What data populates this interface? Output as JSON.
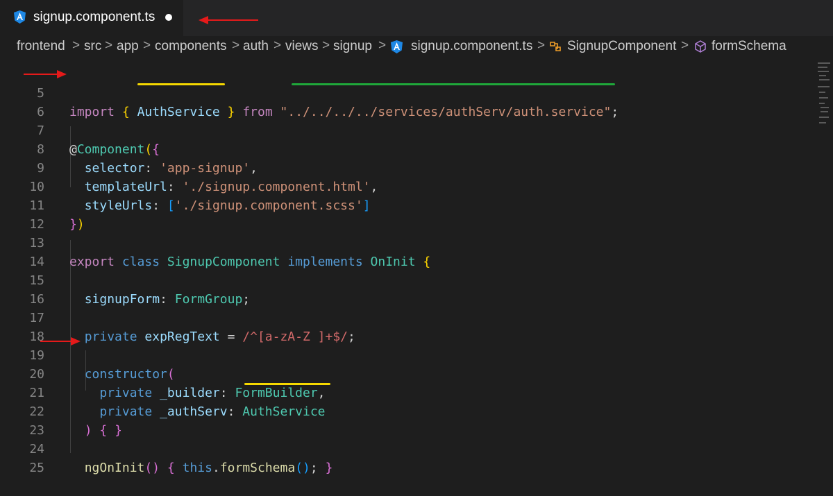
{
  "tab": {
    "title": "signup.component.ts",
    "icon": "angular-icon",
    "dirty": true
  },
  "breadcrumb": {
    "items": [
      "frontend",
      "src",
      "app",
      "components",
      "auth",
      "views",
      "signup",
      "signup.component.ts",
      "SignupComponent",
      "formSchema"
    ],
    "separator": ">"
  },
  "editor": {
    "lines": [
      {
        "n": "5",
        "text": "import { AuthService } from \"../../../../services/authServ/auth.service\";"
      },
      {
        "n": "6",
        "text": ""
      },
      {
        "n": "7",
        "text": "@Component({"
      },
      {
        "n": "8",
        "text": "  selector: 'app-signup',"
      },
      {
        "n": "9",
        "text": "  templateUrl: './signup.component.html',"
      },
      {
        "n": "10",
        "text": "  styleUrls: ['./signup.component.scss']"
      },
      {
        "n": "11",
        "text": "})"
      },
      {
        "n": "12",
        "text": ""
      },
      {
        "n": "13",
        "text": "export class SignupComponent implements OnInit {"
      },
      {
        "n": "14",
        "text": ""
      },
      {
        "n": "15",
        "text": "  signupForm: FormGroup;"
      },
      {
        "n": "16",
        "text": ""
      },
      {
        "n": "17",
        "text": "  private expRegText = /^[a-zA-Z ]+$/;"
      },
      {
        "n": "18",
        "text": ""
      },
      {
        "n": "19",
        "text": "  constructor("
      },
      {
        "n": "20",
        "text": "    private _builder: FormBuilder,"
      },
      {
        "n": "21",
        "text": "    private _authServ: AuthService"
      },
      {
        "n": "22",
        "text": "  ) { }"
      },
      {
        "n": "23",
        "text": ""
      },
      {
        "n": "24",
        "text": "  ngOnInit() { this.formSchema(); }"
      },
      {
        "n": "25",
        "text": ""
      }
    ]
  },
  "colors": {
    "arrow": "#e51a1a",
    "underline_yellow": "#f5d800",
    "underline_green": "#1fa83a"
  }
}
